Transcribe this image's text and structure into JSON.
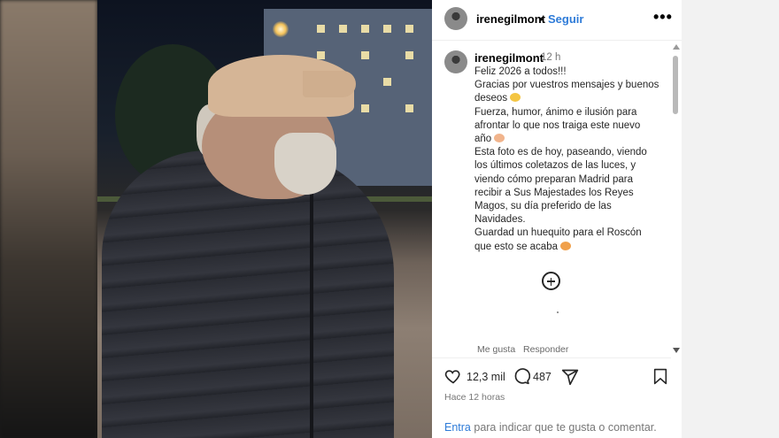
{
  "post": {
    "username": "irenegilmont",
    "separator": "•",
    "follow_label": "Seguir",
    "more_label": "•••"
  },
  "caption": {
    "username": "irenegilmont",
    "time_ago": "12 h",
    "lines": [
      "Feliz 2026 a todos!!!",
      "Gracias por vuestros mensajes y buenos",
      "deseos",
      "Fuerza, humor, ánimo e ilusión para",
      "afrontar lo que nos traiga este nuevo",
      "año",
      "Esta foto es de hoy, paseando, viendo",
      "los últimos coletazos de las luces, y",
      "viendo cómo preparan Madrid para",
      "recibir a Sus Majestades los Reyes",
      "Magos, su día preferido de las",
      "Navidades.",
      "Guardad un huequito para el Roscón",
      "que esto se acaba"
    ],
    "like_label": "Me gusta",
    "reply_label": "Responder"
  },
  "actions": {
    "like_count": "12,3 mil",
    "comment_count": "487"
  },
  "posted_time": "Hace 12 horas",
  "login": {
    "link_text": "Entra",
    "rest_text": " para indicar que te gusta o comentar."
  },
  "colors": {
    "link_blue": "#2e7bd8",
    "text_dark": "#262626",
    "text_muted": "#777777"
  },
  "icons": [
    "more-icon",
    "heart-icon",
    "comment-icon",
    "share-icon",
    "bookmark-icon",
    "add-comment-icon"
  ]
}
